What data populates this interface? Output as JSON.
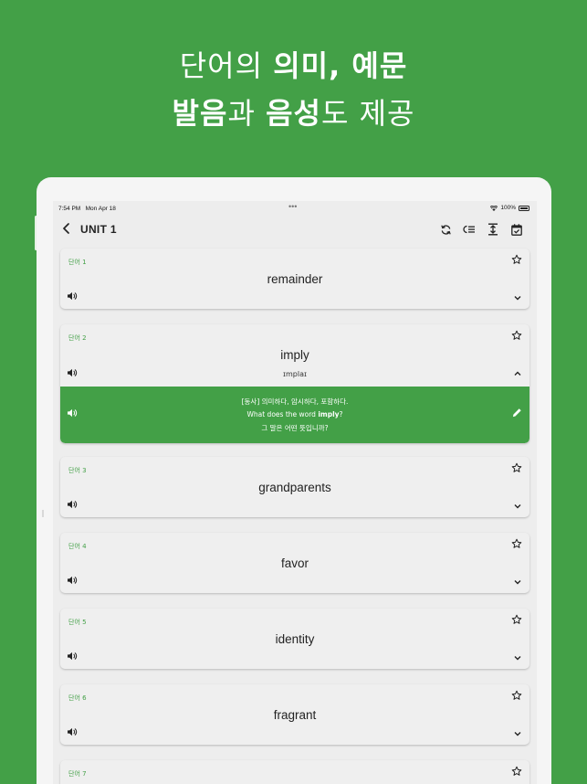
{
  "headline": {
    "line1_pre": "단어의 ",
    "line1_bold": "의미, 예문",
    "line2_bold1": "발음",
    "line2_mid": "과 ",
    "line2_bold2": "음성",
    "line2_post": "도 제공"
  },
  "status": {
    "time": "7:54 PM",
    "date": "Mon Apr 18",
    "dots": "•••",
    "battery": "100%"
  },
  "nav": {
    "title": "UNIT 1"
  },
  "colors": {
    "accent": "#43a047",
    "background": "#43a047"
  },
  "cards": [
    {
      "label": "단어 1",
      "word": "remainder"
    },
    {
      "label": "단어 2",
      "word": "imply",
      "pron": "ɪmplaɪ",
      "meaning": "[동사] 의미하다, 암시하다, 포함하다.",
      "example_pre": "What does the word ",
      "example_bold": "imply",
      "example_post": "?",
      "translation": "그 말은 어떤 뜻입니까?"
    },
    {
      "label": "단어 3",
      "word": "grandparents"
    },
    {
      "label": "단어 4",
      "word": "favor"
    },
    {
      "label": "단어 5",
      "word": "identity"
    },
    {
      "label": "단어 6",
      "word": "fragrant"
    },
    {
      "label": "단어 7",
      "word": ""
    }
  ],
  "icons": {
    "back": "chevron-left-icon",
    "refresh": "refresh-icon",
    "list": "list-icon",
    "expand": "expand-vertical-icon",
    "calendar": "calendar-check-icon",
    "star": "star-outline-icon",
    "speaker": "speaker-icon",
    "chevron_down": "chevron-down-icon",
    "chevron_up": "chevron-up-icon",
    "edit": "pencil-icon",
    "wifi": "wifi-icon",
    "battery": "battery-icon"
  }
}
